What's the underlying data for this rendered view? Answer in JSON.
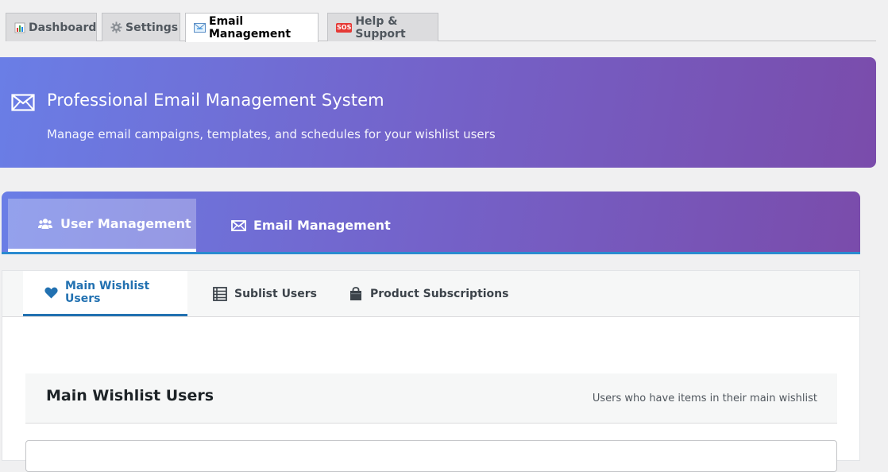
{
  "nav": {
    "tabs": [
      {
        "label": "Dashboard",
        "icon": "bar-chart-icon",
        "active": false
      },
      {
        "label": "Settings",
        "icon": "gear-icon",
        "active": false
      },
      {
        "label": "Email Management",
        "icon": "email-icon",
        "active": true
      },
      {
        "label": "Help & Support",
        "icon": "sos-icon",
        "active": false
      }
    ],
    "sos_text": "SOS"
  },
  "banner": {
    "title": "Professional Email Management System",
    "subtitle": "Manage email campaigns, templates, and schedules for your wishlist users"
  },
  "section_tabs": [
    {
      "label": "User Management",
      "icon": "users-icon",
      "active": true
    },
    {
      "label": "Email Management",
      "icon": "envelope-icon",
      "active": false
    }
  ],
  "sub_tabs": [
    {
      "label": "Main Wishlist Users",
      "icon": "heart-icon",
      "active": true
    },
    {
      "label": "Sublist Users",
      "icon": "list-icon",
      "active": false
    },
    {
      "label": "Product Subscriptions",
      "icon": "store-icon",
      "active": false
    }
  ],
  "section": {
    "title": "Main Wishlist Users",
    "description": "Users who have items in their main wishlist"
  },
  "colors": {
    "accent": "#2271b1",
    "gradient_start": "#6a7ee6",
    "gradient_end": "#7a4cab"
  }
}
